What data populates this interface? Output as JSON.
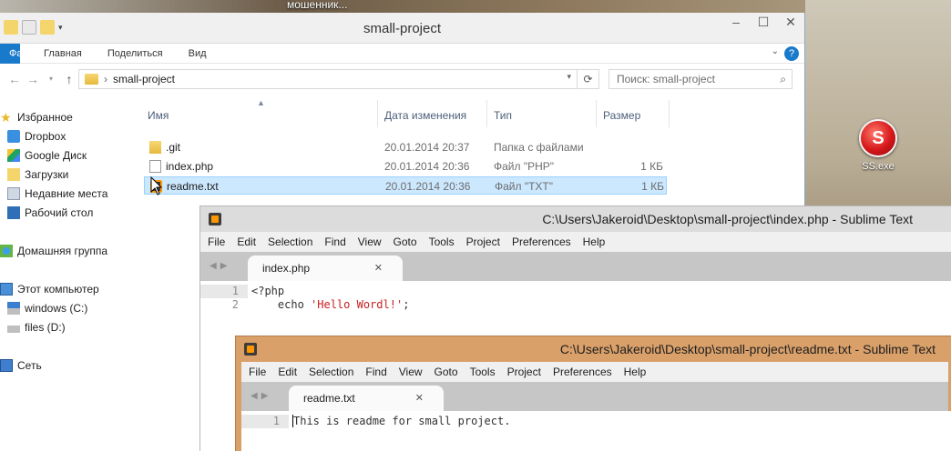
{
  "desktop": {
    "caption": "мошенник...",
    "shortcut_label": "SS.exe",
    "shortcut_glyph": "S"
  },
  "explorer": {
    "title": "small-project",
    "ribbon": {
      "file": "Файл",
      "tabs": [
        "Главная",
        "Поделиться",
        "Вид"
      ],
      "help": "?"
    },
    "address": {
      "path": "small-project",
      "separator": "›"
    },
    "search_placeholder": "Поиск: small-project",
    "sidebar": {
      "favorites": "Избранное",
      "fav_items": [
        "Dropbox",
        "Google Диск",
        "Загрузки",
        "Недавние места",
        "Рабочий стол"
      ],
      "homegroup": "Домашняя группа",
      "computer": "Этот компьютер",
      "drives": [
        "windows (C:)",
        "files (D:)"
      ],
      "network": "Сеть"
    },
    "columns": {
      "name": "Имя",
      "date": "Дата изменения",
      "type": "Тип",
      "size": "Размер"
    },
    "files": [
      {
        "name": ".git",
        "date": "20.01.2014 20:37",
        "type": "Папка с файлами",
        "size": ""
      },
      {
        "name": "index.php",
        "date": "20.01.2014 20:36",
        "type": "Файл \"PHP\"",
        "size": "1 КБ"
      },
      {
        "name": "readme.txt",
        "date": "20.01.2014 20:36",
        "type": "Файл \"TXT\"",
        "size": "1 КБ"
      }
    ]
  },
  "sublime1": {
    "title": "C:\\Users\\Jakeroid\\Desktop\\small-project\\index.php - Sublime Text",
    "menu": [
      "File",
      "Edit",
      "Selection",
      "Find",
      "View",
      "Goto",
      "Tools",
      "Project",
      "Preferences",
      "Help"
    ],
    "tab": "index.php",
    "lines": [
      {
        "num": "1",
        "code": "<?php"
      },
      {
        "num": "2",
        "code": "    echo ",
        "string": "'Hello Wordl!'",
        "tail": ";"
      }
    ]
  },
  "sublime2": {
    "title": "C:\\Users\\Jakeroid\\Desktop\\small-project\\readme.txt - Sublime Text",
    "menu": [
      "File",
      "Edit",
      "Selection",
      "Find",
      "View",
      "Goto",
      "Tools",
      "Project",
      "Preferences",
      "Help"
    ],
    "tab": "readme.txt",
    "lines": [
      {
        "num": "1",
        "code": "This is readme for small project."
      }
    ]
  },
  "colors": {
    "selection": "#cce8ff",
    "accent": "#1979ca",
    "sublime_inactive": "#d9a06a"
  }
}
